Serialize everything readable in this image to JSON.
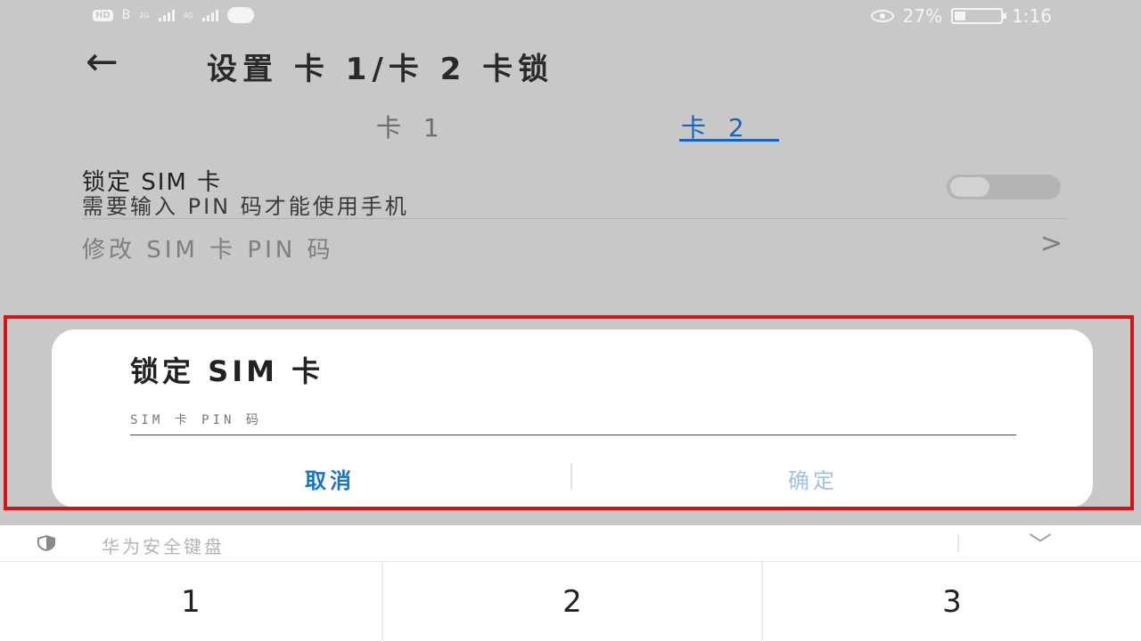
{
  "status_bar": {
    "left_badges": [
      "HD",
      "B"
    ],
    "network_1": "2G",
    "network_2": "4G",
    "battery_percent": "27%",
    "time": "1:16",
    "icons": [
      "hd-icon",
      "signal-icon",
      "signal-icon",
      "carrier-logo-icon",
      "eye-icon",
      "battery-icon"
    ]
  },
  "header": {
    "back_icon": "←",
    "title": "设置 卡 1/卡 2 卡锁"
  },
  "tabs": [
    {
      "label": "卡 1",
      "selected": false
    },
    {
      "label": "卡 2",
      "selected": true
    }
  ],
  "settings": {
    "lock_sim": {
      "title": "锁定 SIM 卡",
      "subtitle": "需要输入 PIN 码才能使用手机",
      "enabled": false
    },
    "change_pin": {
      "label": "修改 SIM 卡 PIN 码",
      "chevron": ">"
    }
  },
  "dialog": {
    "title": "锁定 SIM 卡",
    "input_placeholder": "SIM 卡 PIN 码",
    "input_value": "",
    "cancel_label": "取消",
    "confirm_label": "确定",
    "confirm_enabled": false
  },
  "keyboard": {
    "label": "华为安全键盘",
    "collapse_icon": "﹀",
    "keys": [
      "1",
      "2",
      "3"
    ]
  },
  "colors": {
    "accent": "#1565c0",
    "highlight_border": "#d11414",
    "overlay_background": "#c8c8c8"
  }
}
